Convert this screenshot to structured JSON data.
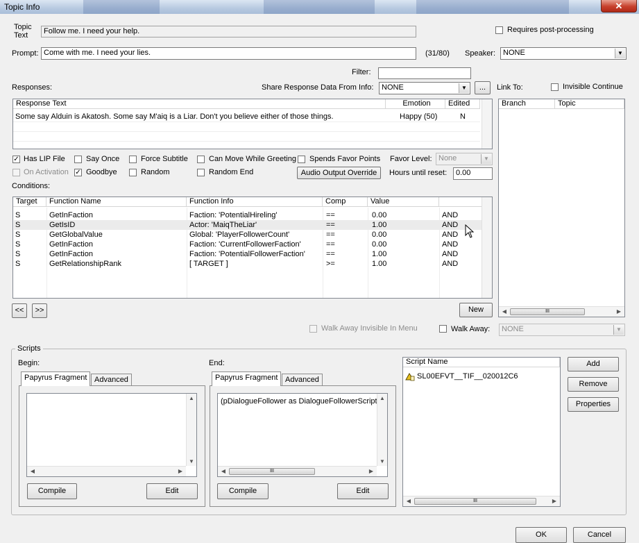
{
  "window": {
    "title": "Topic Info",
    "close_glyph": "✕"
  },
  "topic": {
    "label": "Topic\nText",
    "value": "Follow me. I need your help."
  },
  "requires_post_processing": {
    "label": "Requires post-processing",
    "checked": false
  },
  "prompt": {
    "label": "Prompt:",
    "value": "Come with me. I need your lies.",
    "count": "(31/80)"
  },
  "speaker": {
    "label": "Speaker:",
    "value": "NONE"
  },
  "filter": {
    "label": "Filter:",
    "value": ""
  },
  "responses": {
    "label": "Responses:",
    "share_label": "Share Response Data From Info:",
    "share_value": "NONE",
    "ellipsis": "...",
    "columns": [
      "Response Text",
      "Emotion",
      "Edited"
    ],
    "rows": [
      {
        "text": "Some say Alduin is Akatosh. Some say M'aiq is a Liar. Don't you believe either of those things.",
        "emotion": "Happy (50)",
        "edited": "N"
      }
    ]
  },
  "link_to": {
    "label": "Link To:",
    "invisible_continue": "Invisible Continue",
    "columns": [
      "Branch",
      "Topic"
    ]
  },
  "flags": {
    "has_lip": {
      "label": "Has LIP File",
      "checked": true
    },
    "say_once": {
      "label": "Say Once",
      "checked": false
    },
    "force_subtitle": {
      "label": "Force Subtitle",
      "checked": false
    },
    "can_move": {
      "label": "Can Move While Greeting",
      "checked": false
    },
    "spends_favor": {
      "label": "Spends Favor Points",
      "checked": false
    },
    "on_activation": {
      "label": "On Activation",
      "checked": false
    },
    "goodbye": {
      "label": "Goodbye",
      "checked": true
    },
    "random": {
      "label": "Random",
      "checked": false
    },
    "random_end": {
      "label": "Random End",
      "checked": false
    }
  },
  "favor_level": {
    "label": "Favor Level:",
    "value": "None"
  },
  "audio_override": {
    "label": "Audio Output Override"
  },
  "hours_reset": {
    "label": "Hours until reset:",
    "value": "0.00"
  },
  "conditions": {
    "label": "Conditions:",
    "columns": [
      "Target",
      "Function Name",
      "Function Info",
      "Comp",
      "Value",
      ""
    ],
    "rows": [
      {
        "target": "S",
        "func": "GetInFaction",
        "info": "Faction: 'PotentialHireling'",
        "comp": "==",
        "value": "0.00",
        "op": "AND"
      },
      {
        "target": "S",
        "func": "GetIsID",
        "info": "Actor: 'MaiqTheLiar'",
        "comp": "==",
        "value": "1.00",
        "op": "AND"
      },
      {
        "target": "S",
        "func": "GetGlobalValue",
        "info": "Global: 'PlayerFollowerCount'",
        "comp": "==",
        "value": "0.00",
        "op": "AND"
      },
      {
        "target": "S",
        "func": "GetInFaction",
        "info": "Faction: 'CurrentFollowerFaction'",
        "comp": "==",
        "value": "0.00",
        "op": "AND"
      },
      {
        "target": "S",
        "func": "GetInFaction",
        "info": "Faction: 'PotentialFollowerFaction'",
        "comp": "==",
        "value": "1.00",
        "op": "AND"
      },
      {
        "target": "S",
        "func": "GetRelationshipRank",
        "info": "[ TARGET ]",
        "comp": ">=",
        "value": "1.00",
        "op": "AND"
      }
    ],
    "prev": "<<",
    "next": ">>",
    "new": "New"
  },
  "walk_away_invisible": {
    "label": "Walk Away Invisible In Menu"
  },
  "walk_away": {
    "label": "Walk Away:",
    "value": "NONE"
  },
  "scripts": {
    "label": "Scripts",
    "begin": {
      "label": "Begin:",
      "tab1": "Papyrus Fragment",
      "tab2": "Advanced",
      "content": "",
      "compile": "Compile",
      "edit": "Edit"
    },
    "end": {
      "label": "End:",
      "tab1": "Papyrus Fragment",
      "tab2": "Advanced",
      "content": "(pDialogueFollower as DialogueFollowerScript)",
      "compile": "Compile",
      "edit": "Edit"
    },
    "list_header": "Script Name",
    "list_items": [
      "SL00EFVT__TIF__020012C6"
    ],
    "add": "Add",
    "remove": "Remove",
    "properties": "Properties"
  },
  "footer": {
    "ok": "OK",
    "cancel": "Cancel"
  },
  "scroll_grip": "III"
}
